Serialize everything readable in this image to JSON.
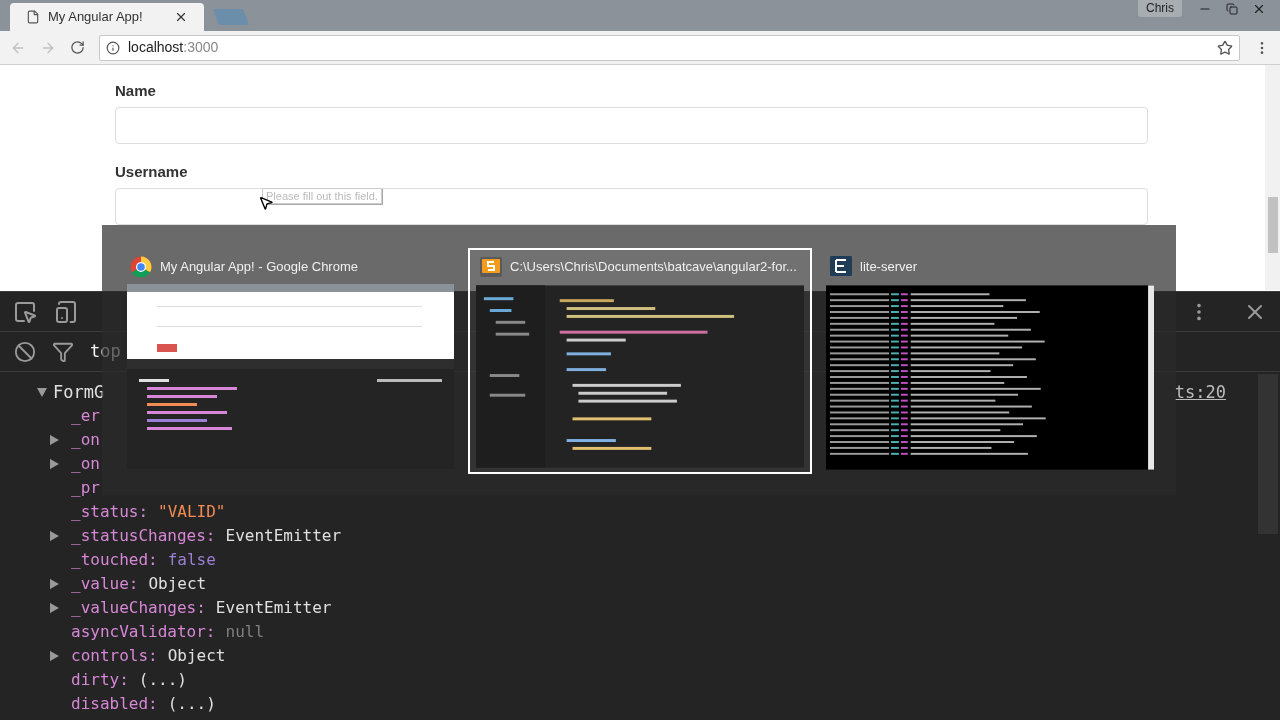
{
  "browser": {
    "tabs": [
      {
        "title": "My Angular App!",
        "selected": true
      }
    ],
    "profile": "Chris",
    "address": {
      "host": "localhost",
      "port": ":3000"
    }
  },
  "form": {
    "fields": [
      {
        "label": "Name"
      },
      {
        "label": "Username"
      }
    ],
    "tooltip": "Please fill out this field."
  },
  "devtools": {
    "filter_context": "top",
    "source_link": "ts:20",
    "tree": {
      "key": "FormG",
      "expanded": true,
      "children": [
        {
          "key": "_er",
          "expandable": false
        },
        {
          "key": "_on",
          "expandable": true,
          "expanded": false
        },
        {
          "key": "_on",
          "expandable": true,
          "expanded": false
        },
        {
          "key": "_pr",
          "expandable": false
        },
        {
          "key": "_status:",
          "value": "\"VALID\"",
          "kind": "string",
          "expandable": false
        },
        {
          "key": "_statusChanges:",
          "value": "EventEmitter",
          "kind": "object",
          "expandable": true,
          "expanded": false
        },
        {
          "key": "_touched:",
          "value": "false",
          "kind": "boolean",
          "expandable": false
        },
        {
          "key": "_value:",
          "value": "Object",
          "kind": "object",
          "expandable": true,
          "expanded": false
        },
        {
          "key": "_valueChanges:",
          "value": "EventEmitter",
          "kind": "object",
          "expandable": true,
          "expanded": false
        },
        {
          "key": "asyncValidator:",
          "value": "null",
          "kind": "null",
          "expandable": false
        },
        {
          "key": "controls:",
          "value": "Object",
          "kind": "object",
          "expandable": true,
          "expanded": false
        },
        {
          "key": "dirty:",
          "value": "(...)",
          "kind": "getter",
          "expandable": false
        },
        {
          "key": "disabled:",
          "value": "(...)",
          "kind": "getter",
          "expandable": false
        }
      ]
    }
  },
  "task_switcher": {
    "windows": [
      {
        "title": "My Angular App! - Google Chrome",
        "kind": "browser",
        "selected": false
      },
      {
        "title": "C:\\Users\\Chris\\Documents\\batcave\\angular2-for...",
        "kind": "editor",
        "selected": true
      },
      {
        "title": "lite-server",
        "kind": "terminal",
        "selected": false
      }
    ]
  }
}
